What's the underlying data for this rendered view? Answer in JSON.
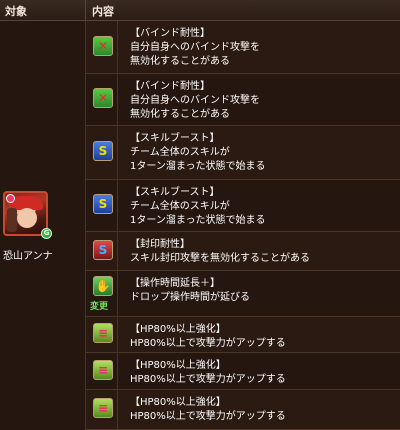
{
  "header": {
    "target": "対象",
    "content": "内容"
  },
  "character": {
    "name": "恐山アンナ",
    "orb_label": "G"
  },
  "skills": [
    {
      "icon": "bind-resist-icon",
      "title": "【バインド耐性】",
      "lines": [
        "自分自身へのバインド攻撃を",
        "無効化することがある"
      ],
      "change": ""
    },
    {
      "icon": "bind-resist-icon",
      "title": "【バインド耐性】",
      "lines": [
        "自分自身へのバインド攻撃を",
        "無効化することがある"
      ],
      "change": ""
    },
    {
      "icon": "skill-boost-icon",
      "title": "【スキルブースト】",
      "lines": [
        "チーム全体のスキルが",
        "1ターン溜まった状態で始まる"
      ],
      "change": ""
    },
    {
      "icon": "skill-boost-icon",
      "title": "【スキルブースト】",
      "lines": [
        "チーム全体のスキルが",
        "1ターン溜まった状態で始まる"
      ],
      "change": ""
    },
    {
      "icon": "seal-resist-icon",
      "title": "【封印耐性】",
      "lines": [
        "スキル封印攻撃を無効化することがある"
      ],
      "change": ""
    },
    {
      "icon": "time-extend-plus-icon",
      "title": "【操作時間延長＋】",
      "lines": [
        "ドロップ操作時間が延びる"
      ],
      "change": "変更"
    },
    {
      "icon": "hp80-enhance-icon",
      "title": "【HP80%以上強化】",
      "lines": [
        "HP80%以上で攻撃力がアップする"
      ],
      "change": ""
    },
    {
      "icon": "hp80-enhance-icon",
      "title": "【HP80%以上強化】",
      "lines": [
        "HP80%以上で攻撃力がアップする"
      ],
      "change": ""
    },
    {
      "icon": "hp80-enhance-icon",
      "title": "【HP80%以上強化】",
      "lines": [
        "HP80%以上で攻撃力がアップする"
      ],
      "change": ""
    }
  ]
}
